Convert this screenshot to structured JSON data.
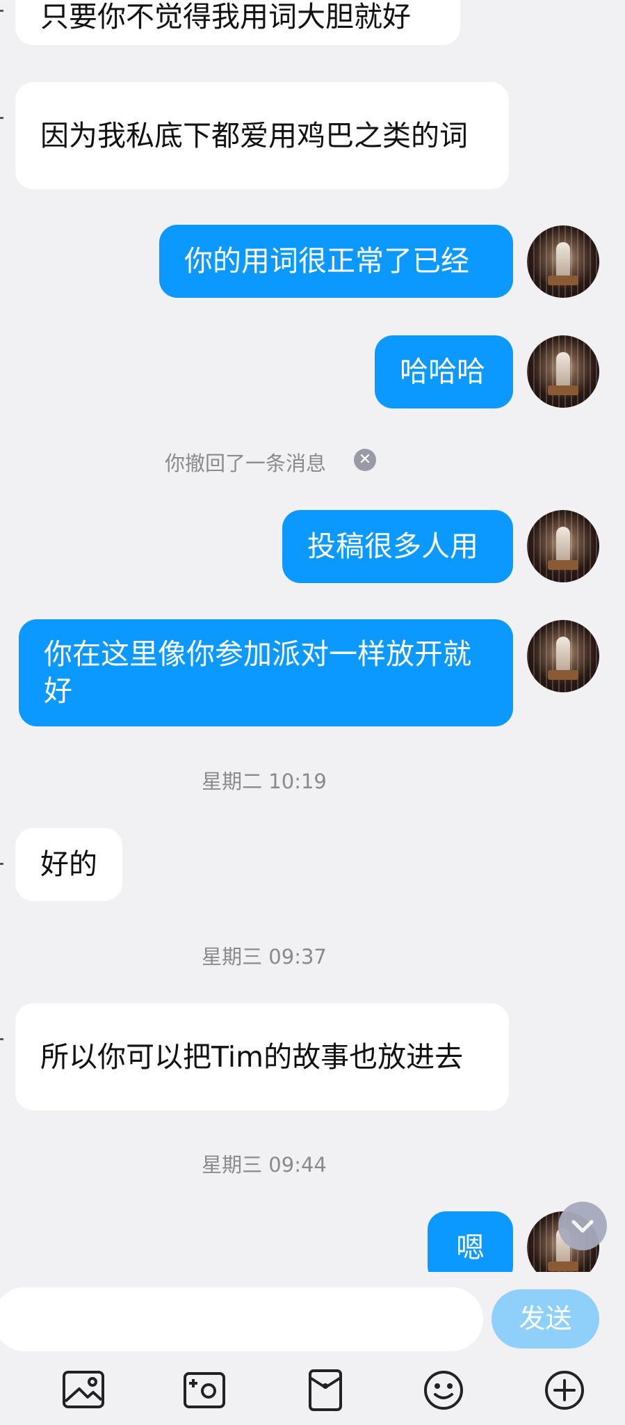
{
  "messages": [
    {
      "text": "只要你不觉得我用词大胆就好"
    },
    {
      "text": "因为我私底下都爱用鸡巴之类的词"
    },
    {
      "text": "你的用词很正常了已经"
    },
    {
      "text": "哈哈哈"
    },
    {
      "text": "投稿很多人用"
    },
    {
      "text": "你在这里像你参加派对一样放开就好"
    },
    {
      "text": "好的"
    },
    {
      "text": "所以你可以把Tim的故事也放进去"
    },
    {
      "text": "嗯"
    }
  ],
  "recall_notice": "你撤回了一条消息",
  "timestamps": [
    "星期二 10:19",
    "星期三 09:37",
    "星期三 09:44"
  ],
  "input": {
    "placeholder": ""
  },
  "send_label": "发送",
  "toolbar_icons": [
    "image-icon",
    "camera-icon",
    "red-packet-icon",
    "emoji-icon",
    "plus-icon"
  ],
  "colors": {
    "outgoing_bubble": "#0b99ff",
    "incoming_bubble": "#ffffff",
    "background": "#f1f1f3",
    "send_button": "#8fd0fb"
  }
}
